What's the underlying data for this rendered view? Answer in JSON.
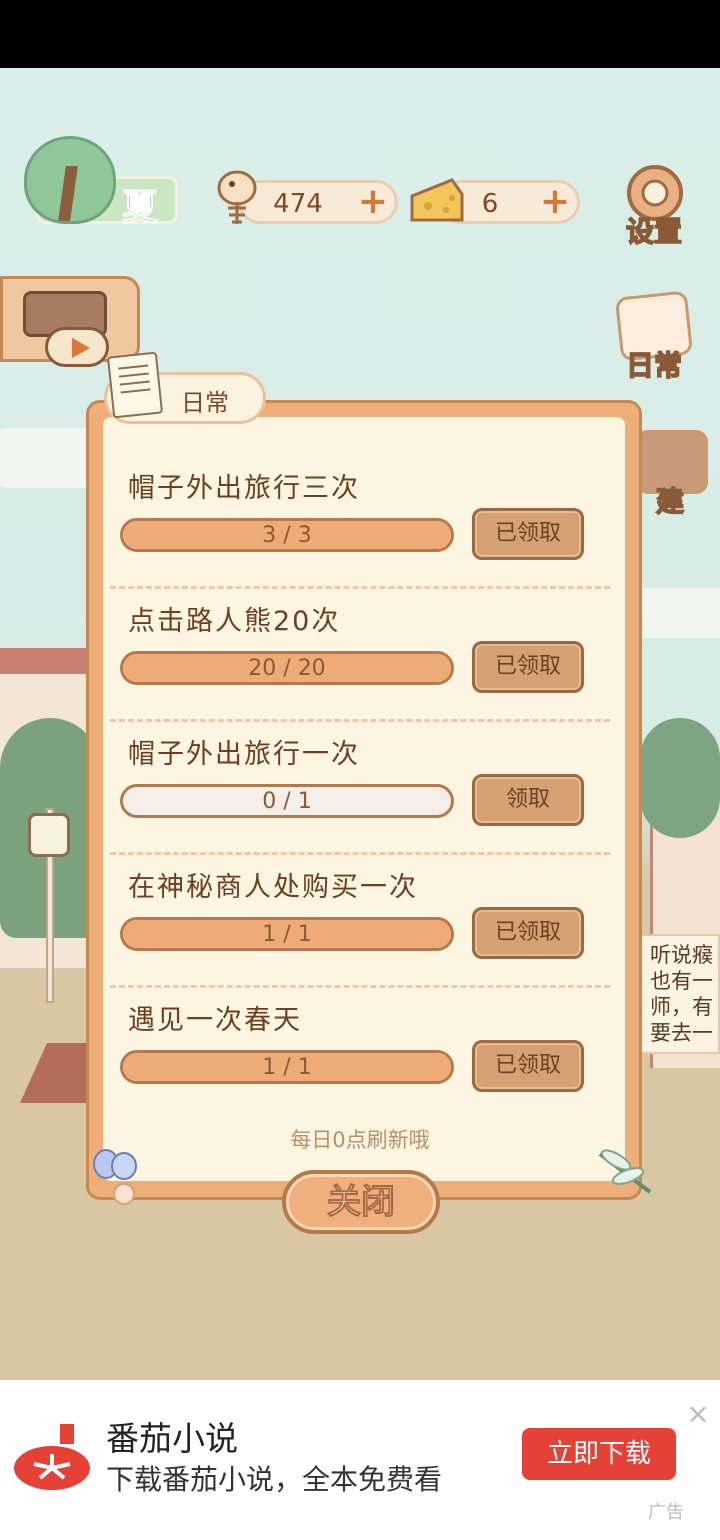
{
  "hud": {
    "season": "夏",
    "fish_count": "474",
    "cheese_count": "6",
    "plus": "+",
    "settings_label": "设置",
    "daily_label": "日常",
    "build_label": "建"
  },
  "panel": {
    "tab_label": "日常",
    "tasks": [
      {
        "title": "帽子外出旅行三次",
        "progress": "3 / 3",
        "fraction": 1.0,
        "button": "已领取"
      },
      {
        "title": "点击路人熊20次",
        "progress": "20 / 20",
        "fraction": 1.0,
        "button": "已领取"
      },
      {
        "title": "帽子外出旅行一次",
        "progress": "0 / 1",
        "fraction": 0.0,
        "button": "领取"
      },
      {
        "title": "在神秘商人处购买一次",
        "progress": "1 / 1",
        "fraction": 1.0,
        "button": "已领取"
      },
      {
        "title": "遇见一次春天",
        "progress": "1 / 1",
        "fraction": 1.0,
        "button": "已领取"
      }
    ],
    "refresh_note": "每日0点刷新哦",
    "close_label": "关闭"
  },
  "notice": {
    "lines": [
      "听说瘊",
      "也有一",
      "师，有",
      "要去一"
    ]
  },
  "ad": {
    "title": "番茄小说",
    "subtitle": "下载番茄小说，全本免费看",
    "cta": "立即下载",
    "close": "×",
    "tag": "广告",
    "brand_color": "#e64136"
  }
}
